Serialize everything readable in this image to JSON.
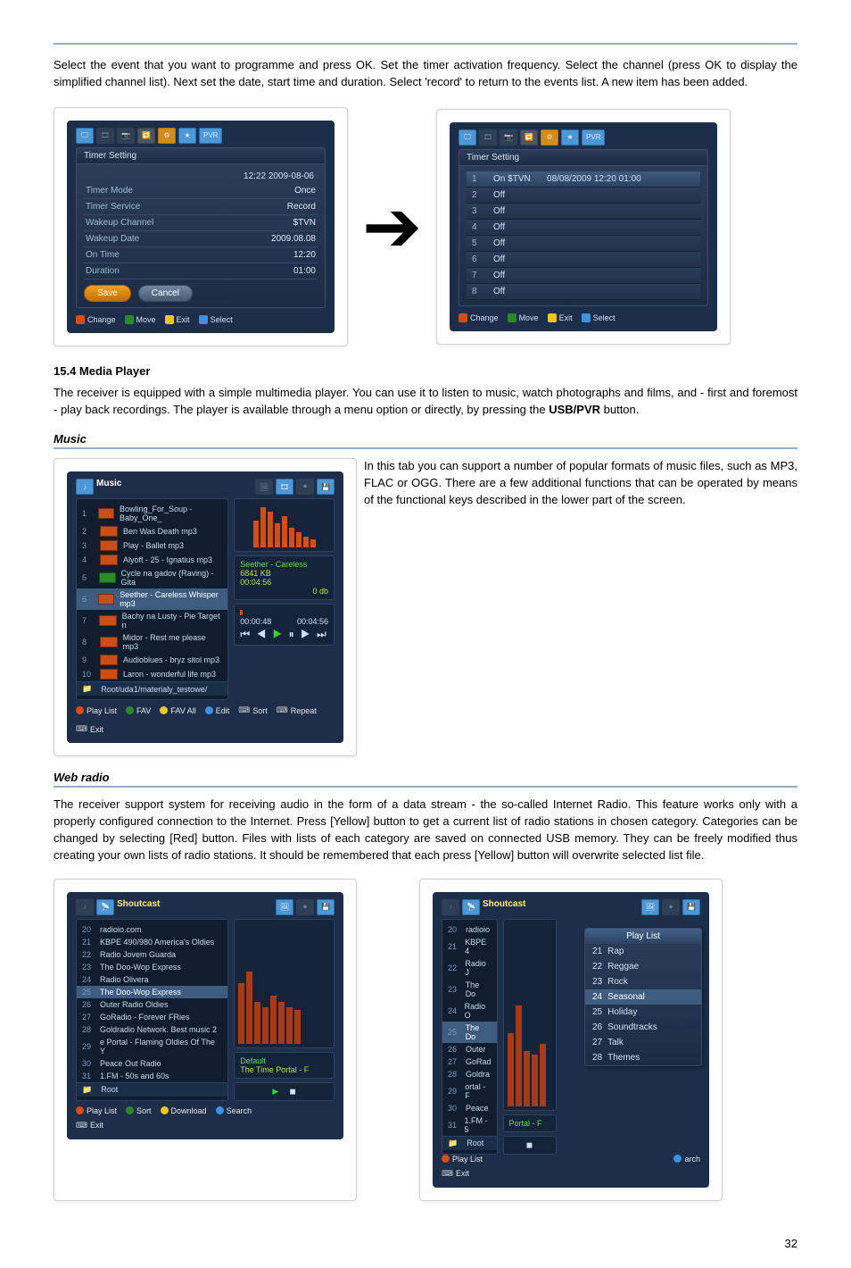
{
  "intro": "Select the event that you want to programme and press OK. Set the timer activation frequency. Select the channel (press OK to display the simplified channel list). Next set the date, start time and duration. Select 'record' to return to the events list. A new item has been added.",
  "pvr_badge": "PVR",
  "timer_setting": {
    "title": "Timer Setting",
    "clock": "12:22 2009-08-06",
    "rows": [
      {
        "k": "Timer Mode",
        "v": "Once"
      },
      {
        "k": "Timer Service",
        "v": "Record"
      },
      {
        "k": "Wakeup Channel",
        "v": "$TVN"
      },
      {
        "k": "Wakeup Date",
        "v": "2009.08.08"
      },
      {
        "k": "On Time",
        "v": "12:20"
      },
      {
        "k": "Duration",
        "v": "01:00"
      }
    ],
    "save": "Save",
    "cancel": "Cancel",
    "hints": [
      {
        "c": "#d64c13",
        "t": "Change"
      },
      {
        "c": "#2a8a2a",
        "t": "Move"
      },
      {
        "c": "#f0c61e",
        "t": "Exit"
      },
      {
        "c": "#3a92e2",
        "t": "Select"
      }
    ]
  },
  "events": {
    "title": "Timer Setting",
    "rows": [
      {
        "n": "1",
        "s": "On $TVN",
        "w": "08/08/2009 12:20 01:00",
        "sel": true
      },
      {
        "n": "2",
        "s": "Off",
        "w": ""
      },
      {
        "n": "3",
        "s": "Off",
        "w": ""
      },
      {
        "n": "4",
        "s": "Off",
        "w": ""
      },
      {
        "n": "5",
        "s": "Off",
        "w": ""
      },
      {
        "n": "6",
        "s": "Off",
        "w": ""
      },
      {
        "n": "7",
        "s": "Off",
        "w": ""
      },
      {
        "n": "8",
        "s": "Off",
        "w": ""
      }
    ],
    "hints": [
      {
        "c": "#d64c13",
        "t": "Change"
      },
      {
        "c": "#2a8a2a",
        "t": "Move"
      },
      {
        "c": "#f0c61e",
        "t": "Exit"
      },
      {
        "c": "#3a92e2",
        "t": "Select"
      }
    ]
  },
  "media_player": {
    "heading": "15.4 Media Player",
    "para": "The receiver is equipped with a simple multimedia player. You can use it to listen to music, watch photographs and films, and - first and foremost - play back recordings. The player is available through a menu option or directly, by pressing the ",
    "bold": "USB/PVR",
    "tail": " button."
  },
  "music": {
    "heading": "Music",
    "title": "Music",
    "text": "In this tab you can support a number of popular formats of music files, such as MP3, FLAC or OGG. There are a few additional functions that can be operated by means of the functional keys described in the lower part of the screen.",
    "tracks": [
      {
        "n": "1",
        "t": "Bowling_For_Soup - Baby_One_"
      },
      {
        "n": "2",
        "t": "Ben Was Death mp3"
      },
      {
        "n": "3",
        "t": "Play - Ballet mp3"
      },
      {
        "n": "4",
        "t": "Alyoft - 25 - Ignatius mp3"
      },
      {
        "n": "5",
        "t": "Cycle na gadov (Raving) - Gita"
      },
      {
        "n": "6",
        "t": "Seether - Careless Whisper mp3",
        "sel": true
      },
      {
        "n": "7",
        "t": "Bachy na Lusty - Pie Target n"
      },
      {
        "n": "8",
        "t": "Midor - Rest me please mp3"
      },
      {
        "n": "9",
        "t": "Audioblues - bryz sitol mp3"
      },
      {
        "n": "10",
        "t": "Laron - wonderful life mp3"
      }
    ],
    "path": "Root/uda1/materialy_testowe/",
    "now": "Seether - Careless",
    "size": "6841 KB",
    "dur": "00:04:56",
    "vol": "0 db",
    "t1": "00:00:48",
    "t2": "00:04:56",
    "bottom": [
      {
        "c": "#d64c13",
        "t": "Play List"
      },
      {
        "c": "#2a8a2a",
        "t": "FAV"
      },
      {
        "c": "#f0c61e",
        "t": "FAV All"
      },
      {
        "c": "#3a92e2",
        "t": "Edit"
      },
      {
        "c": "#888",
        "t": "Sort"
      },
      {
        "c": "#888",
        "t": "Repeat"
      },
      {
        "c": "#888",
        "t": "Exit"
      }
    ]
  },
  "web_radio": {
    "heading": "Web radio",
    "para": "The receiver support system for receiving audio in the form of a data stream - the so-called Internet Radio. This feature works only with a properly configured connection to the Internet. Press [Yellow] button to get a current list of radio stations in chosen category. Categories can be changed by selecting [Red] button. Files with lists of each category are saved on connected USB memory. They can be freely modified thus creating your own lists of radio stations. It should be remembered that each press [Yellow] button will overwrite selected list file.",
    "title": "Shoutcast",
    "stations": [
      {
        "n": "20",
        "t": "radioio.com"
      },
      {
        "n": "21",
        "t": "KBPE 490/980 America's Oldies"
      },
      {
        "n": "22",
        "t": "Radio Jovem Guarda"
      },
      {
        "n": "23",
        "t": "The Doo-Wop Express"
      },
      {
        "n": "24",
        "t": "Radio Olivera"
      },
      {
        "n": "25",
        "t": "The Doo-Wop Express",
        "sel": true
      },
      {
        "n": "26",
        "t": "Outer Radio Oldies"
      },
      {
        "n": "27",
        "t": "GoRadio - Forever FRies"
      },
      {
        "n": "28",
        "t": "Goldradio Network. Best music 2"
      },
      {
        "n": "29",
        "t": "e Portal - Flaming Oldies Of The Y"
      },
      {
        "n": "30",
        "t": "Peace Out Radio"
      },
      {
        "n": "31",
        "t": "1.FM - 50s and 60s"
      }
    ],
    "root": "Root",
    "now": "Default",
    "now2": "The Time Portal - F",
    "bot1": [
      {
        "c": "#d64c13",
        "t": "Play List"
      },
      {
        "c": "#2a8a2a",
        "t": "Sort"
      },
      {
        "c": "#f0c61e",
        "t": "Download"
      },
      {
        "c": "#3a92e2",
        "t": "Search"
      }
    ],
    "exit": "Exit"
  },
  "cat_popup": {
    "title": "Play List",
    "portal": "Portal - F",
    "search": "arch",
    "items": [
      {
        "n": "21",
        "t": "Rap"
      },
      {
        "n": "22",
        "t": "Reggae"
      },
      {
        "n": "23",
        "t": "Rock"
      },
      {
        "n": "24",
        "t": "Seasonal",
        "sel": true
      },
      {
        "n": "25",
        "t": "Holiday"
      },
      {
        "n": "26",
        "t": "Soundtracks"
      },
      {
        "n": "27",
        "t": "Talk"
      },
      {
        "n": "28",
        "t": "Themes"
      }
    ]
  },
  "page_num": "32"
}
